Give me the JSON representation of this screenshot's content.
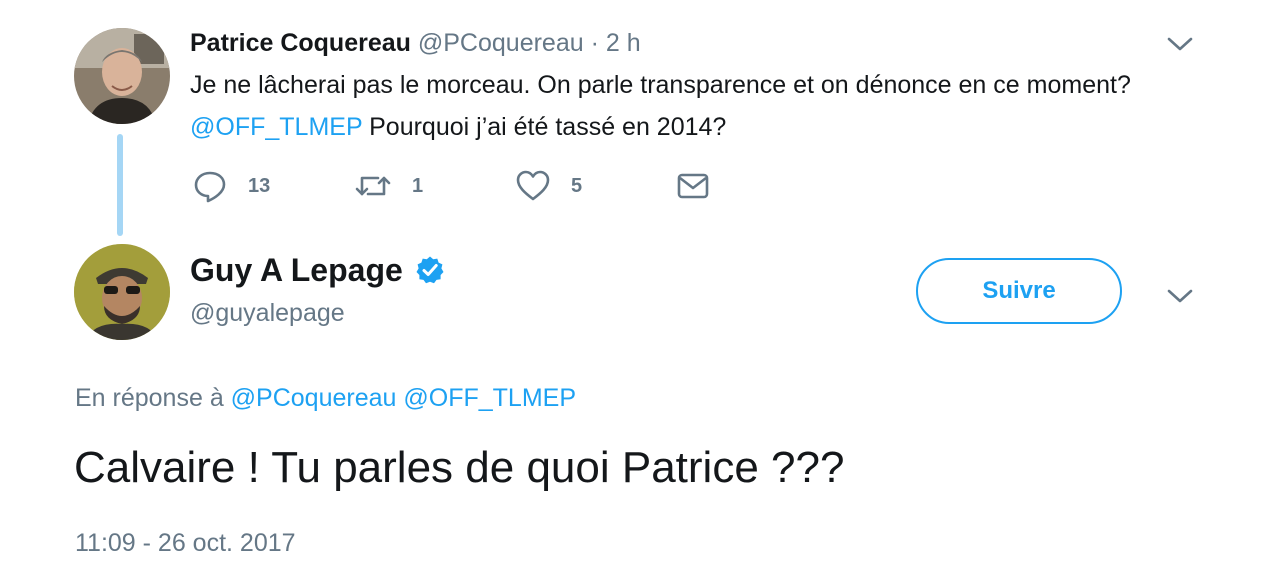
{
  "parent_tweet": {
    "author_name": "Patrice Coquereau",
    "author_handle": "@PCoquereau",
    "separator": "·",
    "time_ago": "2 h",
    "text_part1": "Je ne lâcherai pas le morceau. On parle transparence et on dénonce en ce moment? ",
    "mention": "@OFF_TLMEP",
    "text_part2": " Pourquoi j’ai été tassé en 2014?",
    "replies_count": "13",
    "retweets_count": "1",
    "likes_count": "5",
    "icons": {
      "reply": "reply-icon",
      "retweet": "retweet-icon",
      "like": "heart-icon",
      "dm": "envelope-icon",
      "menu": "chevron-down-icon"
    }
  },
  "main_tweet": {
    "author_name": "Guy A Lepage",
    "author_handle": "@guyalepage",
    "verified": true,
    "follow_label": "Suivre",
    "reply_prefix": "En réponse à",
    "reply_mention_1": "@PCoquereau",
    "reply_mention_2": "@OFF_TLMEP",
    "text": "Calvaire ! Tu parles de quoi Patrice ???",
    "timestamp": "11:09 - 26 oct. 2017"
  },
  "colors": {
    "accent": "#1da1f2",
    "text": "#14171a",
    "secondary": "#657786",
    "thread_line": "#a5d6f5"
  }
}
